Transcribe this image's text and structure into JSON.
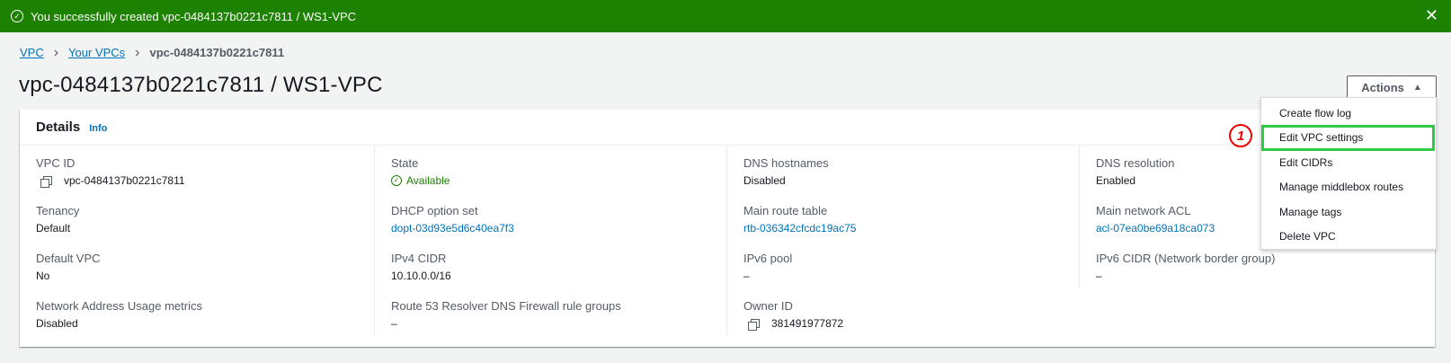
{
  "flash": {
    "message": "You successfully created vpc-0484137b0221c7811 / WS1-VPC",
    "close": "✕",
    "color": "#1d8102"
  },
  "breadcrumb": {
    "items": [
      "VPC",
      "Your VPCs"
    ],
    "current": "vpc-0484137b0221c7811"
  },
  "title": "vpc-0484137b0221c7811 / WS1-VPC",
  "actions": {
    "label": "Actions",
    "caret": "▲"
  },
  "details": {
    "heading": "Details",
    "info": "Info",
    "columns": [
      [
        {
          "label": "VPC ID",
          "value": "vpc-0484137b0221c7811"
        },
        {
          "label": "Tenancy",
          "value": "Default"
        },
        {
          "label": "Default VPC",
          "value": "No"
        },
        {
          "label": "Network Address Usage metrics",
          "value": "Disabled"
        }
      ],
      [
        {
          "label": "State",
          "value": "Available"
        },
        {
          "label": "DHCP option set",
          "value": "dopt-03d93e5d6c40ea7f3"
        },
        {
          "label": "IPv4 CIDR",
          "value": "10.10.0.0/16"
        },
        {
          "label": "Route 53 Resolver DNS Firewall rule groups",
          "value": "–"
        }
      ],
      [
        {
          "label": "DNS hostnames",
          "value": "Disabled"
        },
        {
          "label": "Main route table",
          "value": "rtb-036342cfcdc19ac75"
        },
        {
          "label": "IPv6 pool",
          "value": "–"
        },
        {
          "label": "Owner ID",
          "value": "381491977872"
        }
      ],
      [
        {
          "label": "DNS resolution",
          "value": "Enabled"
        },
        {
          "label": "Main network ACL",
          "value": "acl-07ea0be69a18ca073"
        },
        {
          "label": "IPv6 CIDR (Network border group)",
          "value": "–"
        }
      ]
    ]
  },
  "menu": {
    "items": [
      "Create flow log",
      "Edit VPC settings",
      "Edit CIDRs",
      "Manage middlebox routes",
      "Manage tags",
      "Delete VPC"
    ]
  },
  "step_marker": "1",
  "colors": {
    "link": "#0073bb",
    "success": "#1d8102",
    "highlight": "#2ecc40",
    "step": "#ee0000"
  }
}
